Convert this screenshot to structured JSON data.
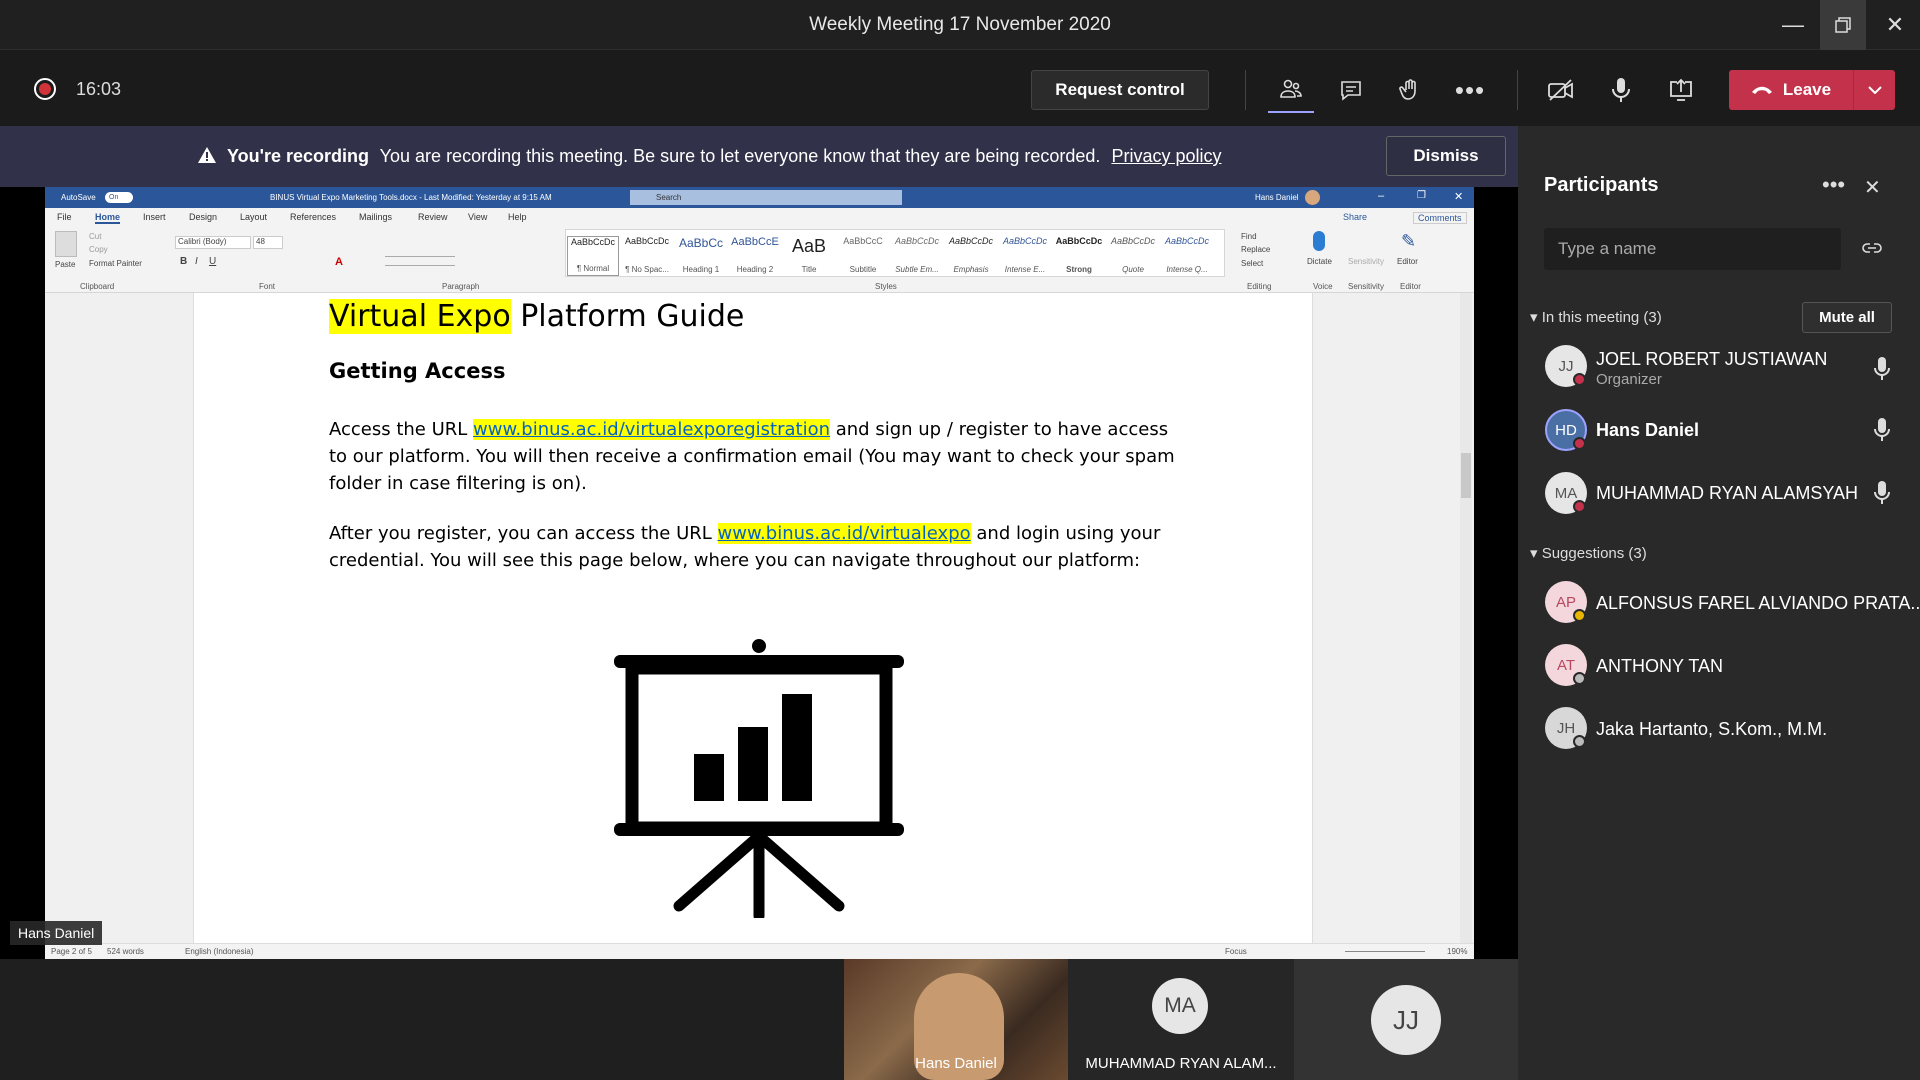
{
  "window": {
    "title": "Weekly Meeting 17 November 2020"
  },
  "controls": {
    "timer": "16:03",
    "request_control": "Request control",
    "leave": "Leave"
  },
  "banner": {
    "bold": "You're recording",
    "message": "You are recording this meeting. Be sure to let everyone know that they are being recorded.",
    "link": "Privacy policy",
    "dismiss": "Dismiss"
  },
  "word": {
    "autosave": "AutoSave",
    "autosave_state": "On",
    "doc_title": "BINUS Virtual Expo Marketing Tools.docx  -  Last Modified: Yesterday at 9:15 AM",
    "search": "Search",
    "user": "Hans Daniel",
    "tabs": [
      "File",
      "Home",
      "Insert",
      "Design",
      "Layout",
      "References",
      "Mailings",
      "Review",
      "View",
      "Help"
    ],
    "share": "Share",
    "comments": "Comments",
    "font_name": "Calibri (Body)",
    "font_size": "48",
    "clipboard_items": [
      "Paste",
      "Cut",
      "Copy",
      "Format Painter"
    ],
    "groups": [
      "Clipboard",
      "Font",
      "Paragraph",
      "Styles",
      "Editing",
      "Voice",
      "Sensitivity",
      "Editor"
    ],
    "styles": [
      {
        "preview": "AaBbCcDc",
        "name": "¶ Normal"
      },
      {
        "preview": "AaBbCcDc",
        "name": "¶ No Spac..."
      },
      {
        "preview": "AaBbCc",
        "name": "Heading 1"
      },
      {
        "preview": "AaBbCcE",
        "name": "Heading 2"
      },
      {
        "preview": "AaB",
        "name": "Title"
      },
      {
        "preview": "AaBbCcC",
        "name": "Subtitle"
      },
      {
        "preview": "AaBbCcDc",
        "name": "Subtle Em..."
      },
      {
        "preview": "AaBbCcDc",
        "name": "Emphasis"
      },
      {
        "preview": "AaBbCcDc",
        "name": "Intense E..."
      },
      {
        "preview": "AaBbCcDc",
        "name": "Strong"
      },
      {
        "preview": "AaBbCcDc",
        "name": "Quote"
      },
      {
        "preview": "AaBbCcDc",
        "name": "Intense Q..."
      }
    ],
    "editing": [
      "Find",
      "Replace",
      "Select"
    ],
    "dictate": "Dictate",
    "sensitivity": "Sensitivity",
    "editor": "Editor",
    "status_page": "Page 2 of 5",
    "status_words": "524 words",
    "status_lang": "English (Indonesia)",
    "status_focus": "Focus",
    "zoom": "190%",
    "doc": {
      "h1_highlight": "Virtual Expo",
      "h1_rest": " Platform Guide",
      "h2": "Getting Access",
      "p1_pre": "Access the URL ",
      "p1_link": "www.binus.ac.id/virtualexporegistration",
      "p1_post": " and sign up / register to have access to our platform. You will then receive a confirmation email (You may want to check your spam folder in case filtering is on).",
      "p2_pre": "After you register, you can access the URL ",
      "p2_link": "www.binus.ac.id/virtualexpo",
      "p2_post": " and login using your credential. You will see this page below, where you can navigate throughout our platform:"
    }
  },
  "presenter_label": "Hans Daniel",
  "participants": {
    "title": "Participants",
    "search_placeholder": "Type a name",
    "in_meeting_label": "In this meeting (3)",
    "mute_all": "Mute all",
    "in_meeting": [
      {
        "initials": "JJ",
        "name": "JOEL ROBERT JUSTIAWAN",
        "role": "Organizer"
      },
      {
        "initials": "HD",
        "name": "Hans Daniel",
        "role": ""
      },
      {
        "initials": "MA",
        "name": "MUHAMMAD RYAN ALAMSYAH",
        "role": ""
      }
    ],
    "suggestions_label": "Suggestions (3)",
    "suggestions": [
      {
        "initials": "AP",
        "name": "ALFONSUS FAREL ALVIANDO PRATA..."
      },
      {
        "initials": "AT",
        "name": "ANTHONY TAN"
      },
      {
        "initials": "JH",
        "name": "Jaka Hartanto, S.Kom., M.M."
      }
    ]
  },
  "tiles": [
    {
      "label": "Hans Daniel"
    },
    {
      "initials": "MA",
      "label": "MUHAMMAD RYAN ALAM..."
    },
    {
      "initials": "JJ"
    }
  ],
  "colors": {
    "leave": "#c4314b",
    "banner": "#31314a",
    "word_blue": "#2b579a",
    "highlight": "#ffff00"
  }
}
